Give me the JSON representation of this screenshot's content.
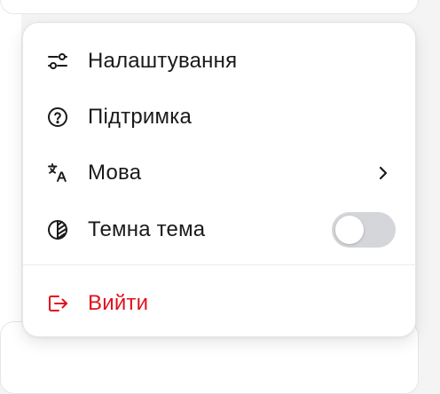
{
  "menu": {
    "items": [
      {
        "label": "Налаштування",
        "icon": "sliders-icon"
      },
      {
        "label": "Підтримка",
        "icon": "help-circle-icon"
      },
      {
        "label": "Мова",
        "icon": "translate-icon",
        "has_submenu": true
      },
      {
        "label": "Темна тема",
        "icon": "contrast-icon",
        "toggle_on": false
      }
    ],
    "logout": {
      "label": "Вийти",
      "icon": "logout-icon"
    }
  },
  "colors": {
    "text": "#1a1a1a",
    "danger": "#e0121c",
    "toggle_off": "#d4d6d9",
    "divider": "#ececee"
  }
}
